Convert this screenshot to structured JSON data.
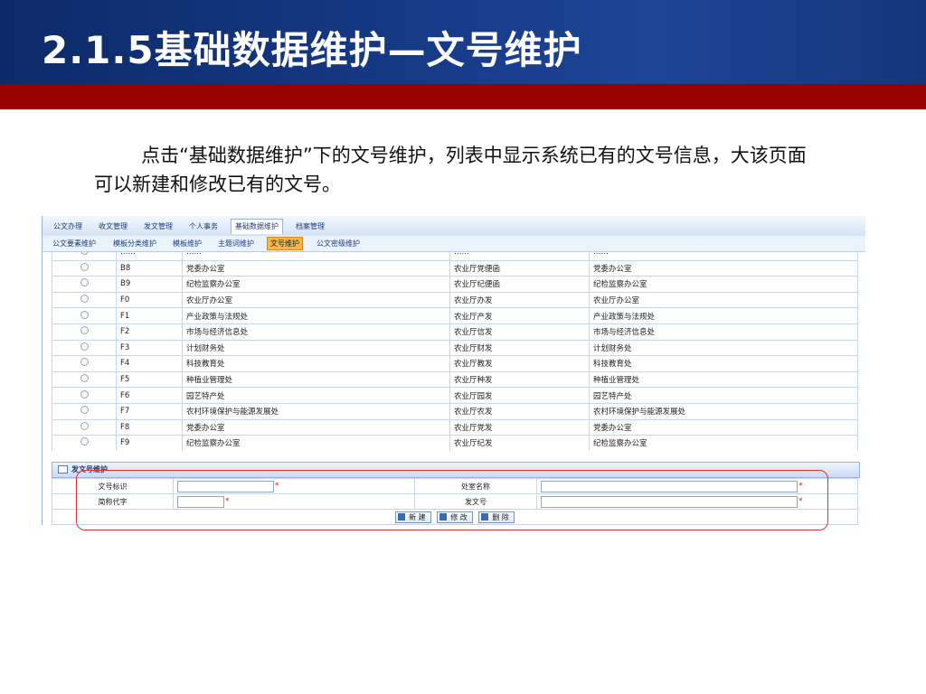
{
  "slide": {
    "title": "2.1.5基础数据维护—文号维护",
    "description": "点击“基础数据维护”下的文号维护，列表中显示系统已有的文号信息，大该页面可以新建和修改已有的文号。"
  },
  "app": {
    "main_menu": [
      "公文办理",
      "收文管理",
      "发文管理",
      "个人事务",
      "基础数据维护",
      "档案管理"
    ],
    "main_menu_active": 4,
    "sub_menu": [
      "公文要素维护",
      "模板分类维护",
      "模板维护",
      "主题词维护",
      "文号维护",
      "公文密级维护"
    ],
    "sub_menu_active": 4,
    "rows": [
      [
        "",
        "……",
        "……",
        "……",
        "……"
      ],
      [
        "",
        "B8",
        "党委办公室",
        "农业厅党便函",
        "党委办公室"
      ],
      [
        "",
        "B9",
        "纪检监察办公室",
        "农业厅纪便函",
        "纪检监察办公室"
      ],
      [
        "",
        "F0",
        "农业厅办公室",
        "农业厅办发",
        "农业厅办公室"
      ],
      [
        "",
        "F1",
        "产业政策与法规处",
        "农业厅产发",
        "产业政策与法规处"
      ],
      [
        "",
        "F2",
        "市场与经济信息处",
        "农业厅信发",
        "市场与经济信息处"
      ],
      [
        "",
        "F3",
        "计划财务处",
        "农业厅财发",
        "计划财务处"
      ],
      [
        "",
        "F4",
        "科技教育处",
        "农业厅教发",
        "科技教育处"
      ],
      [
        "",
        "F5",
        "种植业管理处",
        "农业厅种发",
        "种植业管理处"
      ],
      [
        "",
        "F6",
        "园艺特产处",
        "农业厅园发",
        "园艺特产处"
      ],
      [
        "",
        "F7",
        "农村环境保护与能源发展处",
        "农业厅农发",
        "农村环境保护与能源发展处"
      ],
      [
        "",
        "F8",
        "党委办公室",
        "农业厅党发",
        "党委办公室"
      ],
      [
        "",
        "F9",
        "纪检监察办公室",
        "农业厅纪发",
        "纪检监察办公室"
      ]
    ],
    "form": {
      "title": "发文号维护",
      "label_doc_id": "文号标识",
      "label_dept_name": "处室名称",
      "label_short_code": "简称代字",
      "label_doc_no": "发文号",
      "required_mark": "*",
      "btn_new": "新 建",
      "btn_edit": "修 改",
      "btn_delete": "删 除"
    }
  },
  "colors": {
    "title_bg": "#163a86",
    "red_bar": "#990000",
    "highlight": "#e23030",
    "active_tab": "#f3b64d"
  }
}
